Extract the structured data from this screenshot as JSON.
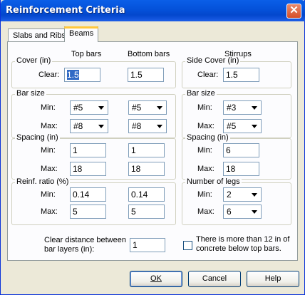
{
  "window": {
    "title": "Reinforcement Criteria",
    "close_glyph": "✕"
  },
  "tabs": [
    {
      "label": "Slabs and Ribs",
      "active": false
    },
    {
      "label": "Beams",
      "active": true
    }
  ],
  "headers": {
    "top_bars": "Top bars",
    "bottom_bars": "Bottom bars",
    "stirrups": "Stirrups"
  },
  "cover": {
    "legend": "Cover (in)",
    "clear_label": "Clear:",
    "top": "1.5",
    "bottom": "1.5"
  },
  "bar_size": {
    "legend": "Bar size",
    "min_label": "Min:",
    "max_label": "Max:",
    "top_min": "#5",
    "top_max": "#8",
    "bottom_min": "#5",
    "bottom_max": "#8"
  },
  "spacing": {
    "legend": "Spacing (in)",
    "min_label": "Min:",
    "max_label": "Max:",
    "top_min": "1",
    "top_max": "18",
    "bottom_min": "1",
    "bottom_max": "18"
  },
  "reinf_ratio": {
    "legend": "Reinf. ratio (%)",
    "min_label": "Min:",
    "max_label": "Max:",
    "top_min": "0.14",
    "top_max": "5",
    "bottom_min": "0.14",
    "bottom_max": "5"
  },
  "stirrups": {
    "side_cover_legend": "Side Cover (in)",
    "clear_label": "Clear:",
    "side_cover": "1.5",
    "bar_size_legend": "Bar size",
    "bar_min_label": "Min:",
    "bar_max_label": "Max:",
    "bar_min": "#3",
    "bar_max": "#5",
    "spacing_legend": "Spacing (in)",
    "spacing_min_label": "Min:",
    "spacing_max_label": "Max:",
    "spacing_min": "6",
    "spacing_max": "18",
    "legs_legend": "Number of legs",
    "legs_min_label": "Min:",
    "legs_max_label": "Max:",
    "legs_min": "2",
    "legs_max": "6"
  },
  "clear_distance": {
    "label_line1": "Clear distance between",
    "label_line2": "bar layers (in):",
    "value": "1"
  },
  "concrete_check": {
    "label_line1": "There is more than 12 in of",
    "label_line2": "concrete below top bars.",
    "checked": false
  },
  "buttons": {
    "ok": "OK",
    "cancel": "Cancel",
    "help": "Help"
  }
}
